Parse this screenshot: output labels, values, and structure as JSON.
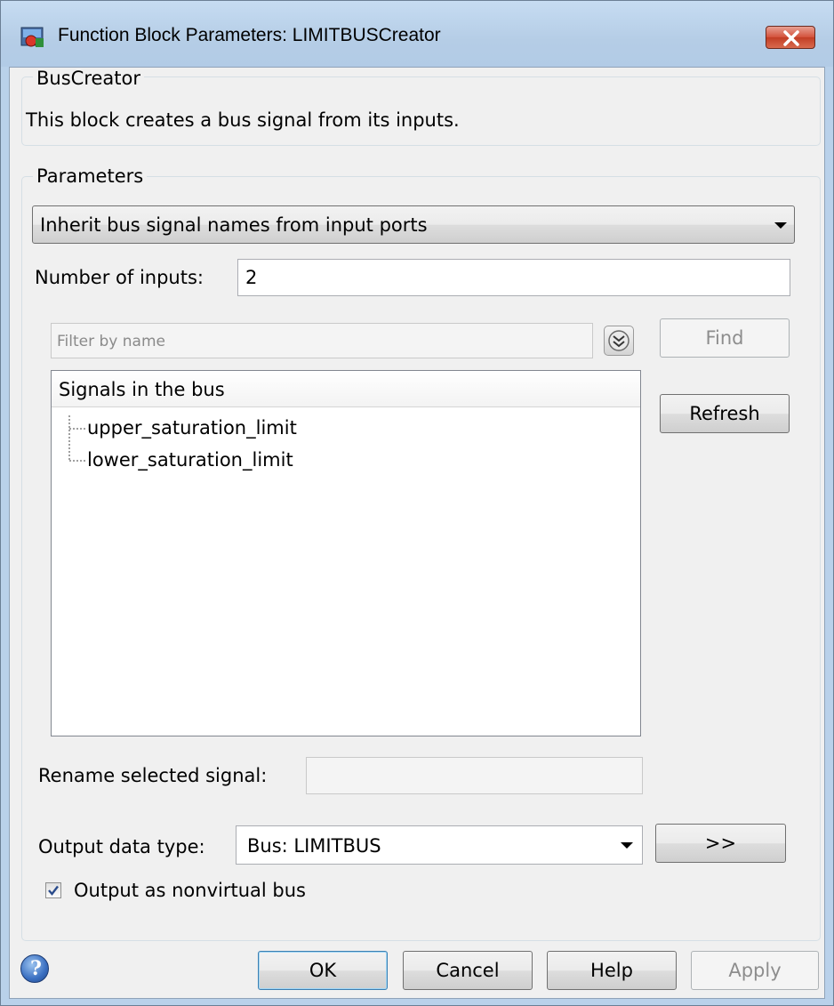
{
  "window": {
    "title": "Function Block Parameters: LIMITBUSCreator",
    "close_icon": "close-icon"
  },
  "description_group": {
    "legend": "BusCreator",
    "text": "This block creates a bus signal from its inputs."
  },
  "parameters": {
    "legend": "Parameters",
    "mode_select": "Inherit bus signal names from input ports",
    "num_inputs_label": "Number of inputs:",
    "num_inputs_value": "2",
    "filter_placeholder": "Filter by name",
    "find_label": "Find",
    "refresh_label": "Refresh",
    "signals_header": "Signals in the bus",
    "signals": [
      "upper_saturation_limit",
      "lower_saturation_limit"
    ],
    "rename_label": "Rename selected signal:",
    "rename_value": "",
    "output_type_label": "Output data type:",
    "output_type_value": "Bus: LIMITBUS",
    "data_type_assistant_label": ">>",
    "nonvirtual_label": "Output as nonvirtual bus",
    "nonvirtual_checked": true
  },
  "footer": {
    "ok": "OK",
    "cancel": "Cancel",
    "help": "Help",
    "apply": "Apply"
  }
}
